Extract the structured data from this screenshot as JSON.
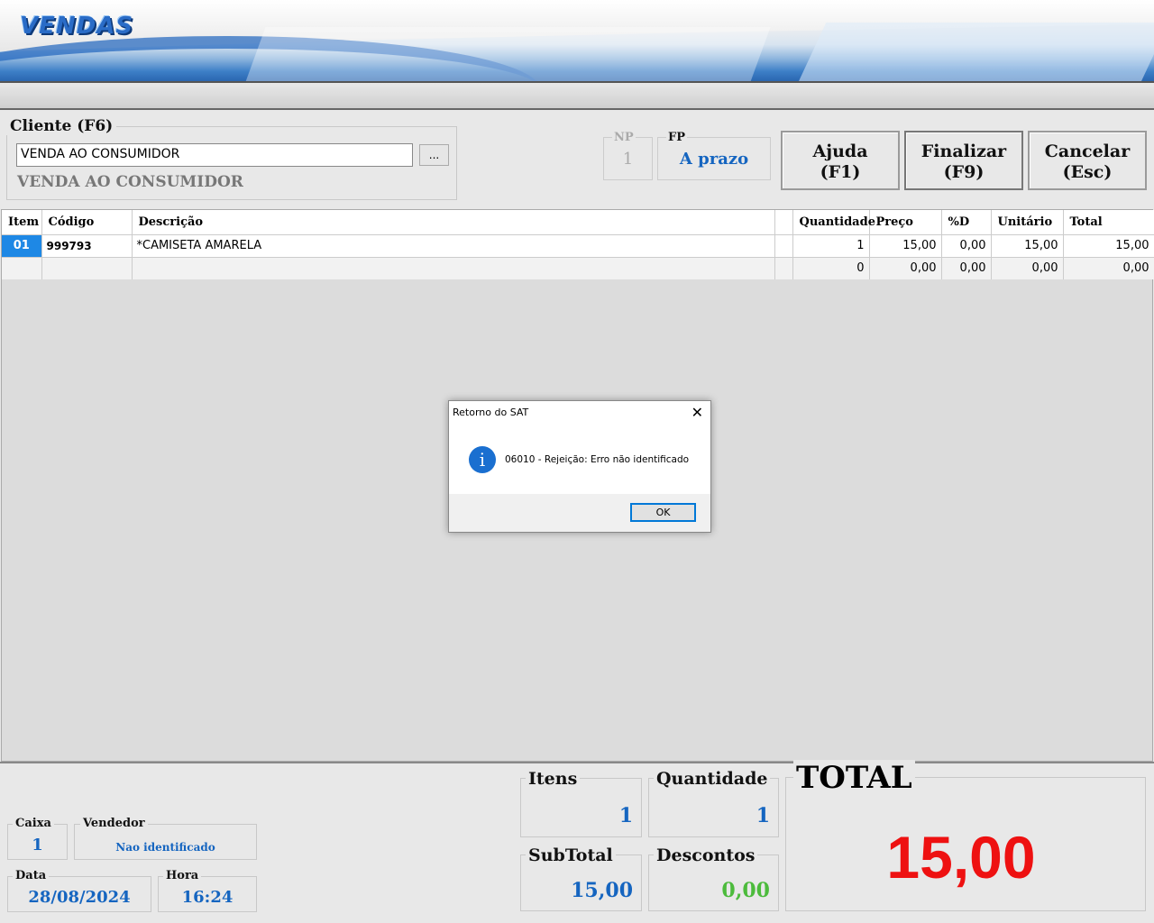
{
  "header": {
    "title": "VENDAS"
  },
  "cliente": {
    "legend": "Cliente (F6)",
    "input_value": "VENDA AO CONSUMIDOR",
    "browse_label": "...",
    "name": "VENDA AO CONSUMIDOR"
  },
  "np": {
    "label": "NP",
    "value": "1"
  },
  "fp": {
    "label": "FP",
    "value": "A prazo"
  },
  "buttons": {
    "ajuda_line1": "Ajuda",
    "ajuda_line2": "(F1)",
    "finalizar_line1": "Finalizar",
    "finalizar_line2": "(F9)",
    "cancelar_line1": "Cancelar",
    "cancelar_line2": "(Esc)"
  },
  "grid": {
    "headers": [
      "Item",
      "Código",
      "Descrição",
      "",
      "Quantidade",
      "Preço",
      "%D",
      "Unitário",
      "Total"
    ],
    "rows": [
      {
        "item": "01",
        "codigo": "999793",
        "descricao": "*CAMISETA AMARELA",
        "extra": "",
        "quantidade": "1",
        "preco": "15,00",
        "desconto": "0,00",
        "unitario": "15,00",
        "total": "15,00"
      },
      {
        "item": "",
        "codigo": "",
        "descricao": "",
        "extra": "",
        "quantidade": "0",
        "preco": "0,00",
        "desconto": "0,00",
        "unitario": "0,00",
        "total": "0,00"
      }
    ]
  },
  "dialog": {
    "title": "Retorno do SAT",
    "close": "✕",
    "icon": "info-icon",
    "message": "06010 - Rejeição: Erro não identificado",
    "ok_label": "OK"
  },
  "footer": {
    "caixa_label": "Caixa",
    "caixa_value": "1",
    "vendedor_label": "Vendedor",
    "vendedor_value": "Nao identificado",
    "data_label": "Data",
    "data_value": "28/08/2024",
    "hora_label": "Hora",
    "hora_value": "16:24",
    "itens_label": "Itens",
    "itens_value": "1",
    "quantidade_label": "Quantidade",
    "quantidade_value": "1",
    "subtotal_label": "SubTotal",
    "subtotal_value": "15,00",
    "descontos_label": "Descontos",
    "descontos_value": "0,00",
    "total_label": "TOTAL",
    "total_value": "15,00"
  },
  "colors": {
    "accent_blue": "#1565c0",
    "selection_blue": "#1e88e5",
    "total_red": "#ee1111",
    "discount_green": "#4cbb3c"
  }
}
